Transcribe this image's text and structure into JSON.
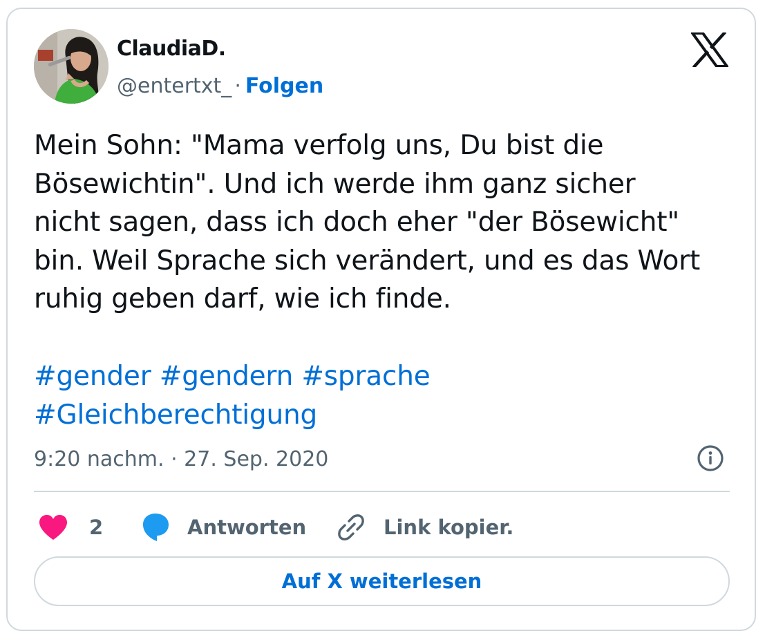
{
  "user": {
    "display_name": "ClaudiaD.",
    "handle": "@entertxt_",
    "separator": "·",
    "follow_label": "Folgen",
    "avatar_icon": "profile-photo"
  },
  "brand": {
    "logo_icon": "x-logo-icon"
  },
  "tweet": {
    "lines": [
      "Mein Sohn: \"Mama verfolg uns, Du bist die",
      "Bösewichtin\". Und ich werde ihm ganz sicher",
      "nicht sagen, dass ich doch eher \"der Bösewicht\"",
      "bin. Weil Sprache sich verändert, und es das Wort",
      "ruhig geben darf, wie ich finde."
    ],
    "hashtags": [
      "#gender",
      "#gendern",
      "#sprache",
      "#Gleichberechtigung"
    ],
    "timestamp": "9:20 nachm. · 27. Sep. 2020"
  },
  "actions": {
    "like_count": "2",
    "reply_label": "Antworten",
    "copy_link_label": "Link kopier."
  },
  "read_more_label": "Auf X weiterlesen",
  "colors": {
    "accent": "#006fd6",
    "like": "#f91880",
    "reply": "#1d9bf0",
    "muted": "#536471",
    "border": "#cfd9de"
  }
}
